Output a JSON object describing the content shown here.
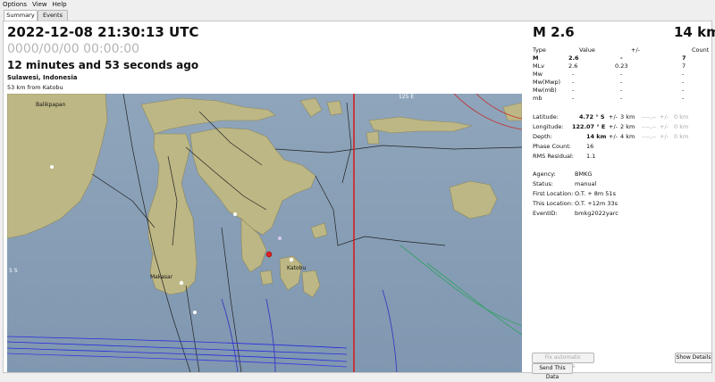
{
  "menu": {
    "options": "Options",
    "view": "View",
    "help": "Help"
  },
  "tabs": {
    "summary": "Summary",
    "events": "Events"
  },
  "event": {
    "time": "2022-12-08 21:30:13 UTC",
    "time_placeholder": "0000/00/00  00:00:00",
    "ago": "12 minutes and 53 seconds ago",
    "region": "Sulawesi, Indonesia",
    "distance": "53 km from Katobu"
  },
  "map": {
    "labels": {
      "balikpapan": "Balikpapan",
      "makassar": "Makasar",
      "katobu": "Katobu",
      "lon": "125 E",
      "lat": "5 S"
    }
  },
  "magnitude_header": {
    "mag": "M 2.6",
    "depth": "14 km"
  },
  "magnitude_table": {
    "headers": {
      "type": "Type",
      "value": "Value",
      "pm": "+/-",
      "count": "Count"
    },
    "rows": [
      {
        "type": "M",
        "value": "2.6",
        "unc": "-",
        "count": "7"
      },
      {
        "type": "MLv",
        "value": "2.6",
        "unc": "0.23",
        "count": "7"
      },
      {
        "type": "Mw",
        "value": "-",
        "unc": "-",
        "count": "-"
      },
      {
        "type": "Mw(Mwp)",
        "value": "-",
        "unc": "-",
        "count": "-"
      },
      {
        "type": "Mw(mB)",
        "value": "-",
        "unc": "-",
        "count": "-"
      },
      {
        "type": "mb",
        "value": "-",
        "unc": "-",
        "count": "-"
      }
    ]
  },
  "location": {
    "latitude_label": "Latitude:",
    "latitude_value": "4.72 ° S",
    "latitude_pm": "+/-",
    "latitude_unc": "3 km",
    "longitude_label": "Longitude:",
    "longitude_value": "122.07 ° E",
    "longitude_pm": "+/-",
    "longitude_unc": "2 km",
    "depth_label": "Depth:",
    "depth_value": "14 km",
    "depth_pm": "+/-",
    "depth_unc": "4 km",
    "phase_label": "Phase Count:",
    "phase_value": "16",
    "rms_label": "RMS Residual:",
    "rms_value": "1.1",
    "faint_dash": "----,--",
    "faint_pm": "+/-",
    "faint_km": "0 km"
  },
  "origin": {
    "agency_label": "Agency:",
    "agency_value": "BMKG",
    "status_label": "Status:",
    "status_value": "manual",
    "first_label": "First Location:",
    "first_value": "O.T. + 8m 51s",
    "this_label": "This Location:",
    "this_value": "O.T. +12m 33s",
    "eventid_label": "EventID:",
    "eventid_value": "bmkg2022yarc"
  },
  "buttons": {
    "fix": "Fix automatic solutions",
    "details": "Show Details",
    "send": "Send This Data"
  },
  "colors": {
    "land": "#bdb785",
    "sea": "#8fa7bd",
    "epicenter": "#e02020",
    "meridian": "#d02020"
  }
}
